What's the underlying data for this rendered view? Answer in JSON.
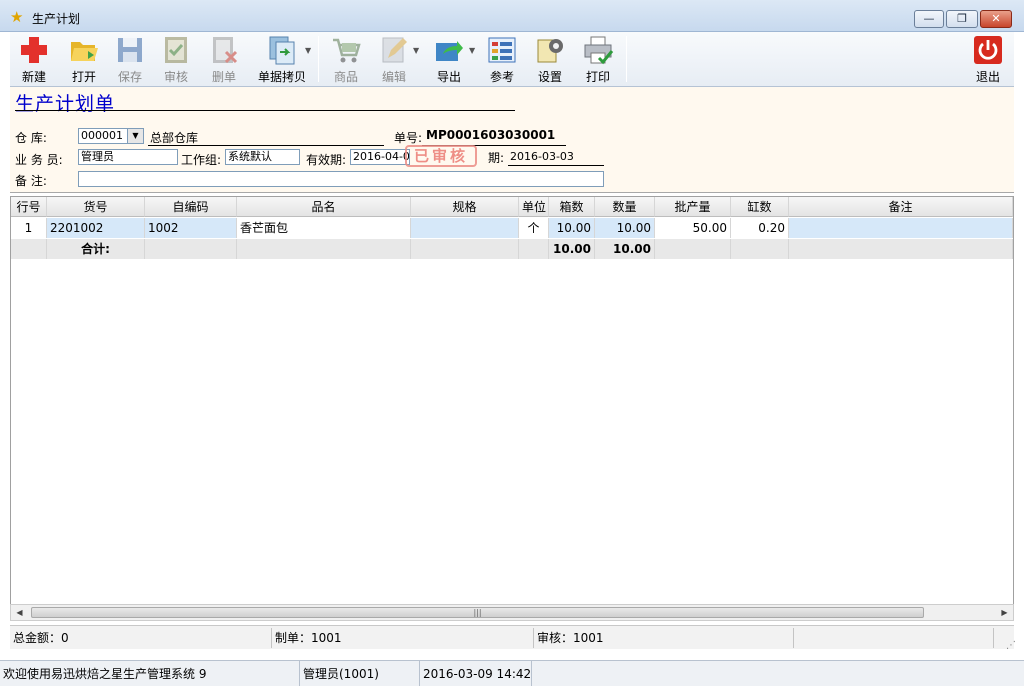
{
  "window": {
    "title": "生产计划",
    "min": "—",
    "max": "❐",
    "close": "✕"
  },
  "toolbar": {
    "new": "新建",
    "open": "打开",
    "save": "保存",
    "audit": "审核",
    "delete": "删单",
    "copy": "单据拷贝",
    "goods": "商品",
    "edit": "编辑",
    "export": "导出",
    "reference": "参考",
    "settings": "设置",
    "print": "打印",
    "exit": "退出"
  },
  "form": {
    "doc_title": "生产计划单",
    "warehouse_label": "仓      库:",
    "warehouse_code": "000001",
    "warehouse_name": "总部仓库",
    "docno_label": "单号:",
    "docno": "MP0001603030001",
    "salesman_label": "业 务 员:",
    "salesman": "管理员",
    "workgroup_label": "工作组:",
    "workgroup": "系统默认",
    "valid_label": "有效期:",
    "valid_date": "2016-04-02",
    "stamp": "已审核",
    "date_label": "期:",
    "date": "2016-03-03",
    "remark_label": "备      注:",
    "remark": ""
  },
  "grid": {
    "columns": [
      "行号",
      "货号",
      "自编码",
      "品名",
      "规格",
      "单位",
      "箱数",
      "数量",
      "批产量",
      "缸数",
      "备注"
    ],
    "rows": [
      {
        "rowno": "1",
        "code": "2201002",
        "selfcode": "1002",
        "name": "香芒面包",
        "spec": "",
        "unit": "个",
        "boxes": "10.00",
        "qty": "10.00",
        "batch": "50.00",
        "vats": "0.20",
        "remark": ""
      }
    ],
    "total": {
      "label": "合计:",
      "boxes": "10.00",
      "qty": "10.00"
    }
  },
  "summary": {
    "amount": "总金额：0",
    "maker": "制单：1001",
    "auditor": "审核：1001"
  },
  "status": {
    "welcome": "欢迎使用易迅烘焙之星生产管理系统 9",
    "user": "管理员(1001)",
    "datetime": "2016-03-09 14:42"
  }
}
